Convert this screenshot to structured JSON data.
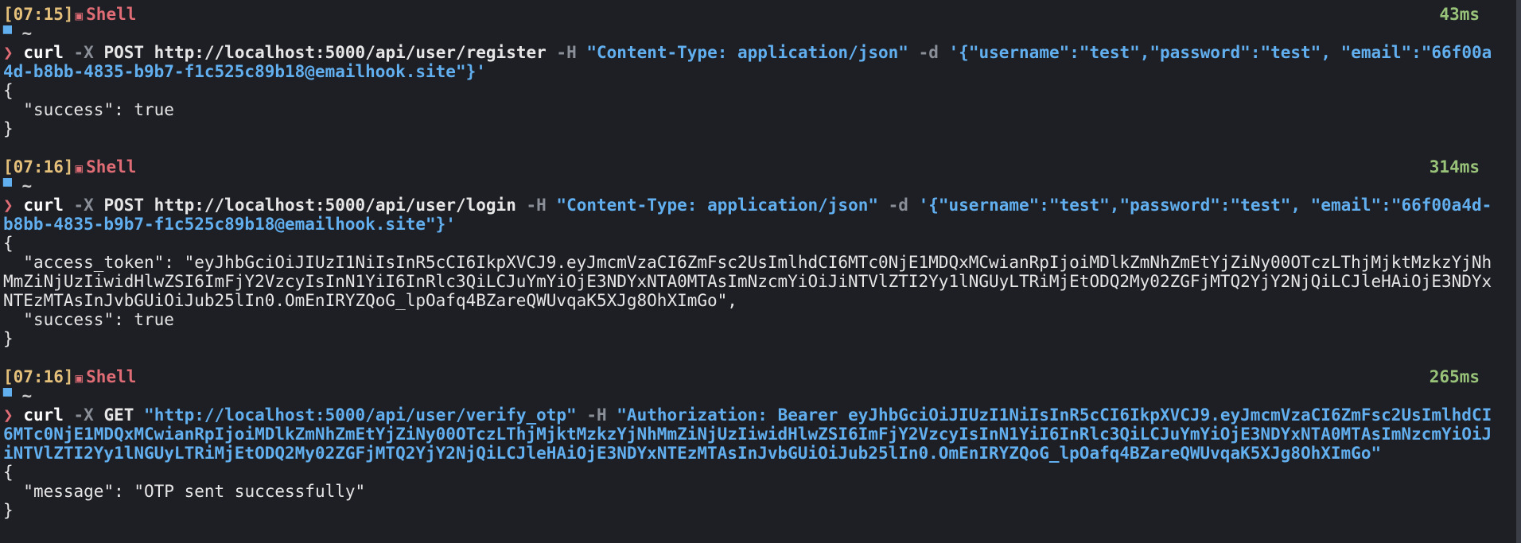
{
  "entries": [
    {
      "time": "[07:15]",
      "shell_icon": "▣",
      "shell_label": "Shell",
      "duration": "43ms",
      "cwd_icon": "folder-icon",
      "cwd": "~",
      "prompt": "❯",
      "cmd": "curl",
      "parts": [
        {
          "t": "flag",
          "v": " -X "
        },
        {
          "t": "arg",
          "v": "POST http://localhost:5000/api/user/register "
        },
        {
          "t": "flag",
          "v": "-H "
        },
        {
          "t": "str",
          "v": "\"Content-Type: application/json\" "
        },
        {
          "t": "flag",
          "v": "-d "
        },
        {
          "t": "str",
          "v": "'{\"username\":\"test\",\"password\":\"test\", \"email\":\"66f00a4d-b8bb-4835-b9b7-f1c525c89b18@emailhook.site\"}'"
        }
      ],
      "output": [
        "{",
        "  \"success\": true",
        "}"
      ]
    },
    {
      "time": "[07:16]",
      "shell_icon": "▣",
      "shell_label": "Shell",
      "duration": "314ms",
      "cwd_icon": "folder-icon",
      "cwd": "~",
      "prompt": "❯",
      "cmd": "curl",
      "parts": [
        {
          "t": "flag",
          "v": " -X "
        },
        {
          "t": "arg",
          "v": "POST http://localhost:5000/api/user/login "
        },
        {
          "t": "flag",
          "v": "-H "
        },
        {
          "t": "str",
          "v": "\"Content-Type: application/json\" "
        },
        {
          "t": "flag",
          "v": "-d "
        },
        {
          "t": "str",
          "v": "'{\"username\":\"test\",\"password\":\"test\", \"email\":\"66f00a4d-b8bb-4835-b9b7-f1c525c89b18@emailhook.site\"}'"
        }
      ],
      "output": [
        "{",
        "  \"access_token\": \"eyJhbGciOiJIUzI1NiIsInR5cCI6IkpXVCJ9.eyJmcmVzaCI6ZmFsc2UsImlhdCI6MTc0NjE1MDQxMCwianRpIjoiMDlkZmNhZmEtYjZiNy00OTczLThjMjktMzkzYjNhMmZiNjUzIiwidHlwZSI6ImFjY2VzcyIsInN1YiI6InRlc3QiLCJuYmYiOjE3NDYxNTA0MTAsImNzcmYiOiJiNTVlZTI2Yy1lNGUyLTRiMjEtODQ2My02ZGFjMTQ2YjY2NjQiLCJleHAiOjE3NDYxNTEzMTAsInJvbGUiOiJub25lIn0.OmEnIRYZQoG_lpOafq4BZareQWUvqaK5XJg8OhXImGo\",",
        "  \"success\": true",
        "}"
      ]
    },
    {
      "time": "[07:16]",
      "shell_icon": "▣",
      "shell_label": "Shell",
      "duration": "265ms",
      "cwd_icon": "folder-icon",
      "cwd": "~",
      "prompt": "❯",
      "cmd": "curl",
      "parts": [
        {
          "t": "flag",
          "v": " -X "
        },
        {
          "t": "arg",
          "v": "GET "
        },
        {
          "t": "str",
          "v": "\"http://localhost:5000/api/user/verify_otp\" "
        },
        {
          "t": "flag",
          "v": "-H "
        },
        {
          "t": "str",
          "v": "\"Authorization: Bearer eyJhbGciOiJIUzI1NiIsInR5cCI6IkpXVCJ9.eyJmcmVzaCI6ZmFsc2UsImlhdCI6MTc0NjE1MDQxMCwianRpIjoiMDlkZmNhZmEtYjZiNy00OTczLThjMjktMzkzYjNhMmZiNjUzIiwidHlwZSI6ImFjY2VzcyIsInN1YiI6InRlc3QiLCJuYmYiOjE3NDYxNTA0MTAsImNzcmYiOiJiNTVlZTI2Yy1lNGUyLTRiMjEtODQ2My02ZGFjMTQ2YjY2NjQiLCJleHAiOjE3NDYxNTEzMTAsInJvbGUiOiJub25lIn0.OmEnIRYZQoG_lpOafq4BZareQWUvqaK5XJg8OhXImGo\""
        }
      ],
      "output": [
        "{",
        "  \"message\": \"OTP sent successfully\"",
        "}"
      ]
    }
  ]
}
